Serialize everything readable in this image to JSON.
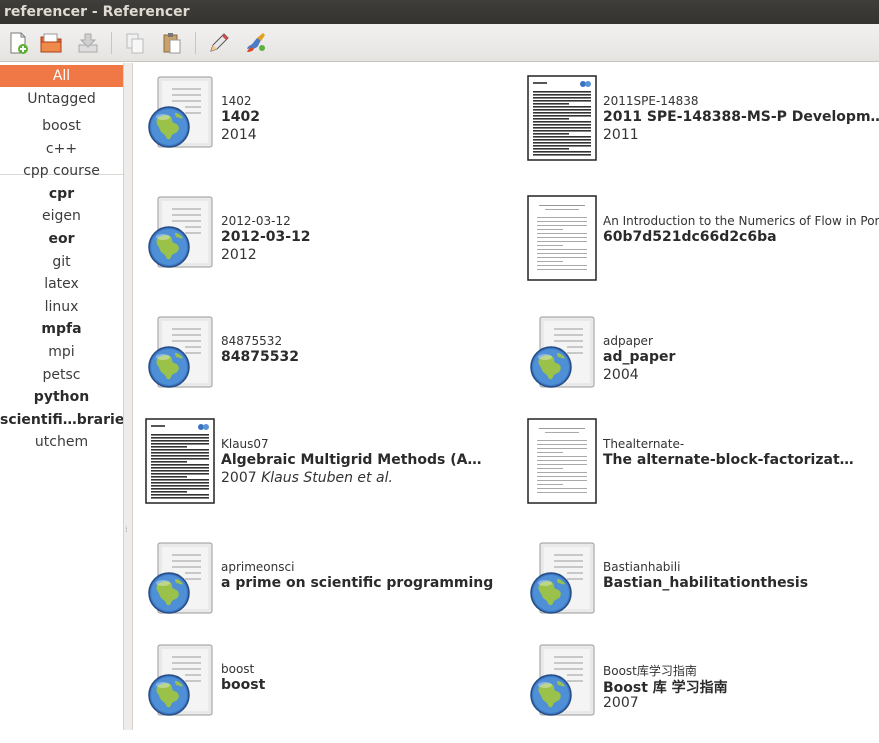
{
  "window": {
    "title": "referencer - Referencer"
  },
  "toolbar": {
    "buttons": [
      "add-document-icon",
      "open-folder-icon",
      "download-icon",
      "copy-icon",
      "paste-icon",
      "pencil-icon",
      "paint-icon"
    ]
  },
  "sidebar": {
    "all": "All",
    "untagged": "Untagged",
    "tags": [
      {
        "label": "boost",
        "bold": false
      },
      {
        "label": "c++",
        "bold": false
      },
      {
        "label": "cpp course",
        "bold": false
      },
      {
        "label": "cpr",
        "bold": true
      },
      {
        "label": "eigen",
        "bold": false
      },
      {
        "label": "eor",
        "bold": true
      },
      {
        "label": "git",
        "bold": false
      },
      {
        "label": "latex",
        "bold": false
      },
      {
        "label": "linux",
        "bold": false
      },
      {
        "label": "mpfa",
        "bold": true
      },
      {
        "label": "mpi",
        "bold": false
      },
      {
        "label": "petsc",
        "bold": false
      },
      {
        "label": "python",
        "bold": true
      },
      {
        "label": "scientifi…braries",
        "bold": true
      },
      {
        "label": "utchem",
        "bold": false
      }
    ]
  },
  "documents": [
    {
      "key": "1402",
      "title": "1402",
      "meta": "2014",
      "author": "",
      "thumb": "globe"
    },
    {
      "key": "2011SPE-14838",
      "title": "2011 SPE-148388-MS-P Developm…",
      "meta": "2011",
      "author": "",
      "thumb": "paper-dense"
    },
    {
      "key": "2012-03-12",
      "title": "2012-03-12",
      "meta": "2012",
      "author": "",
      "thumb": "globe"
    },
    {
      "key": "An Introduction to the Numerics of Flow in Porous",
      "title": "60b7d521dc66d2c6ba",
      "meta": "",
      "author": "",
      "thumb": "paper-light"
    },
    {
      "key": "84875532",
      "title": "84875532",
      "meta": "",
      "author": "",
      "thumb": "globe"
    },
    {
      "key": "adpaper",
      "title": "ad_paper",
      "meta": "2004",
      "author": "",
      "thumb": "globe"
    },
    {
      "key": "Klaus07",
      "title": "Algebraic Multigrid Methods (A…",
      "meta": "2007",
      "author": "Klaus Stuben et al.",
      "thumb": "paper-dense"
    },
    {
      "key": "Thealternate-",
      "title": "The alternate-block-factorizat…",
      "meta": "",
      "author": "",
      "thumb": "paper-light"
    },
    {
      "key": "aprimeonsci",
      "title": "a prime on scientific programming",
      "meta": "",
      "author": "",
      "thumb": "globe"
    },
    {
      "key": "Bastianhabili",
      "title": "Bastian_habilitationthesis",
      "meta": "",
      "author": "",
      "thumb": "globe"
    },
    {
      "key": "boost",
      "title": "boost",
      "meta": "",
      "author": "",
      "thumb": "globe"
    },
    {
      "key": "Boost库学习指南",
      "title": "Boost 库 学习指南",
      "meta": "2007",
      "author": "",
      "thumb": "globe"
    }
  ]
}
